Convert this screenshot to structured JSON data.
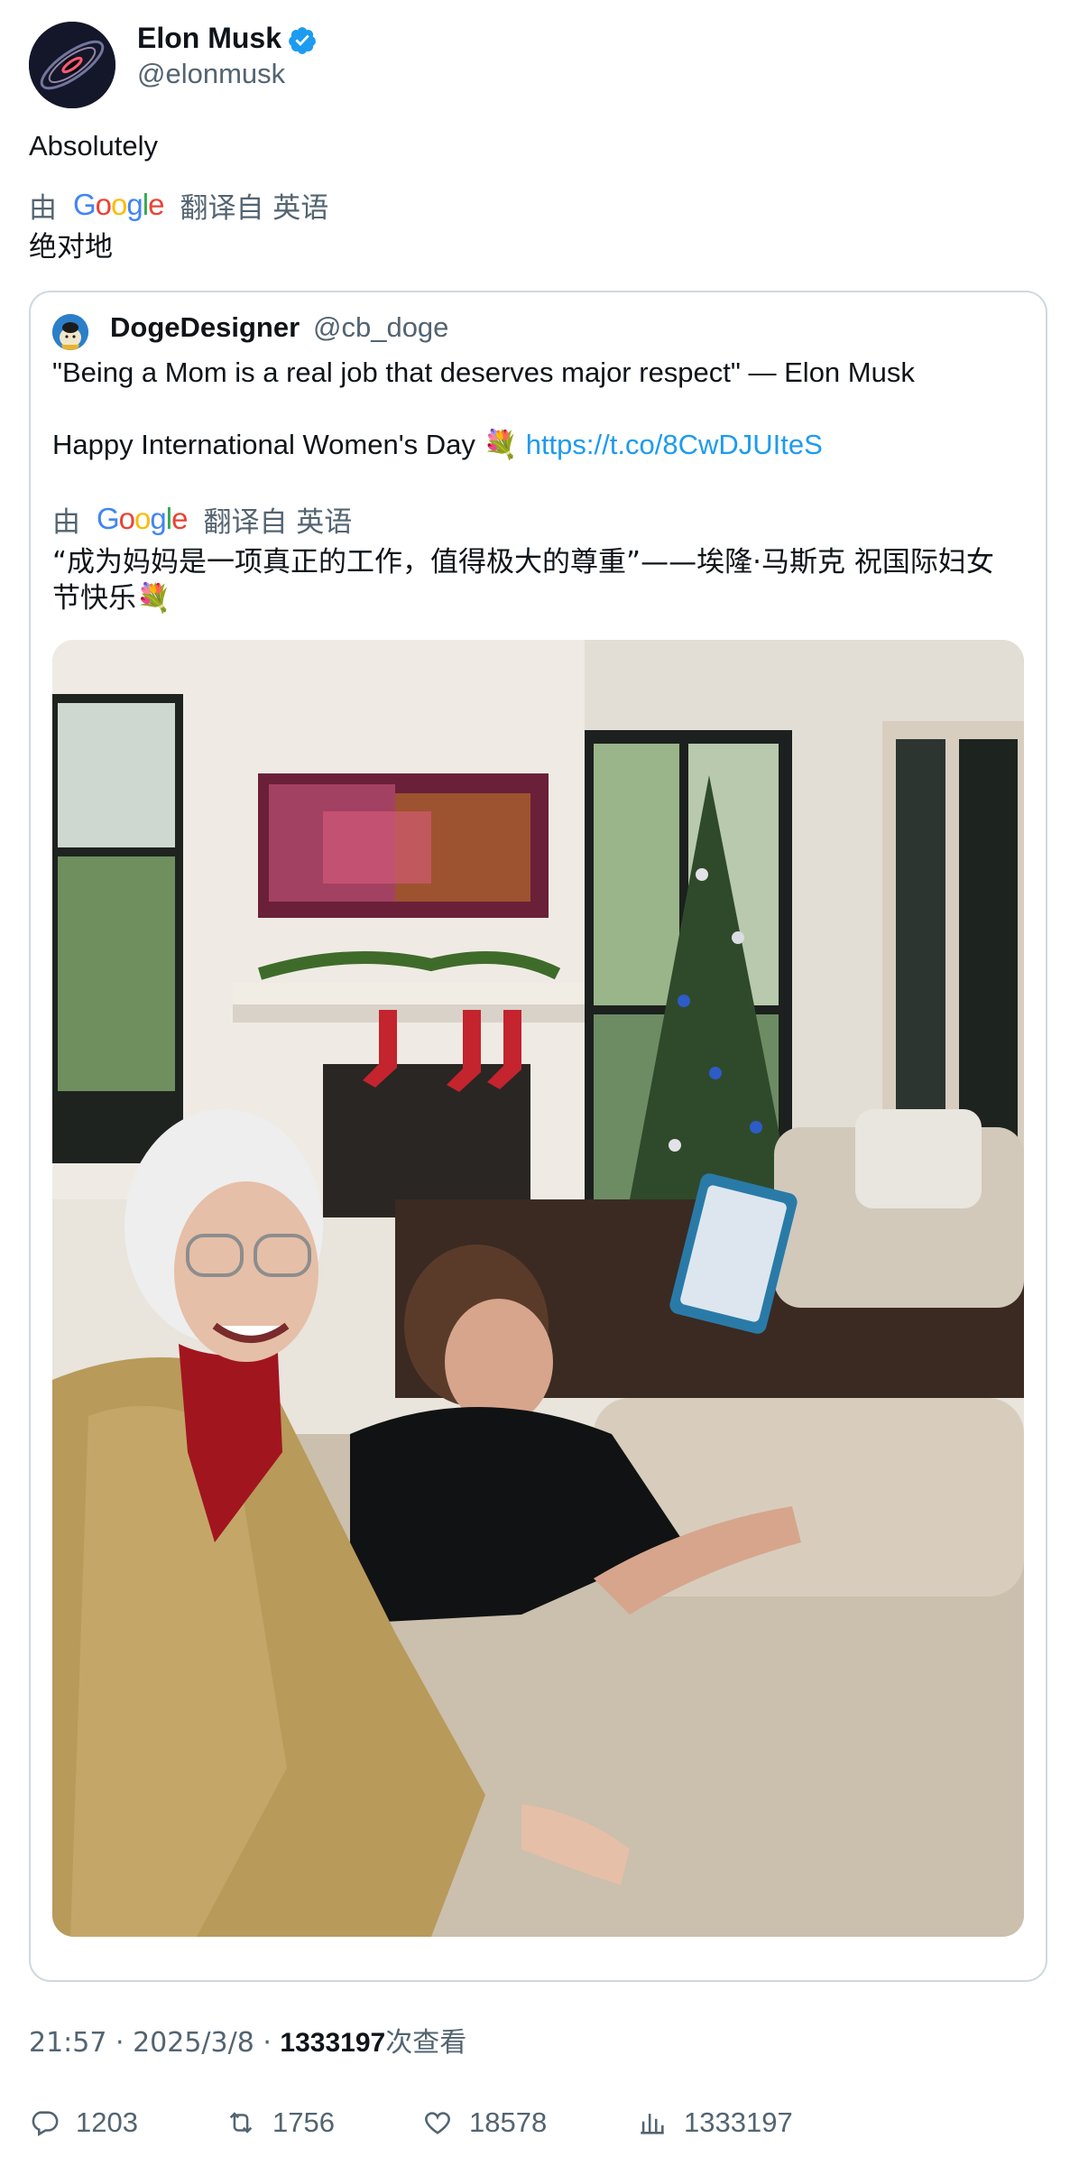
{
  "author": {
    "name": "Elon Musk",
    "handle": "@elonmusk",
    "verified": true,
    "avatar_icon": "galaxy-avatar-icon"
  },
  "tweet": {
    "text": "Absolutely",
    "translation_prefix": "由",
    "translation_suffix": "翻译自 英语",
    "translated_text": "绝对地"
  },
  "quote": {
    "name": "DogeDesigner",
    "handle": "@cb_doge",
    "line1": "\"Being a Mom is a real job that deserves major respect\" — Elon Musk",
    "line2": "Happy International Women's Day 💐",
    "link": "https://t.co/8CwDJUIteS",
    "translation_prefix": "由",
    "translation_suffix": "翻译自 英语",
    "translated_line1": "“成为妈妈是一项真正的工作，值得极大的尊重”——埃隆·马斯克 祝国际妇女",
    "translated_line2": "节快乐💐"
  },
  "google_logo": {
    "letters": [
      "G",
      "o",
      "o",
      "g",
      "l",
      "e"
    ],
    "colors": [
      "#4285f4",
      "#ea4335",
      "#fbbc05",
      "#4285f4",
      "#34a853",
      "#ea4335"
    ]
  },
  "meta": {
    "time": "21:57 · 2025/3/8 · ",
    "views": "1333197",
    "views_suffix": "次查看"
  },
  "actions": {
    "replies": "1203",
    "retweets": "1756",
    "likes": "18578",
    "views": "1333197"
  },
  "colors": {
    "link": "#1d9bf0",
    "secondary_text": "#536471",
    "verified": "#1d9bf0",
    "border": "#cfd9de"
  }
}
